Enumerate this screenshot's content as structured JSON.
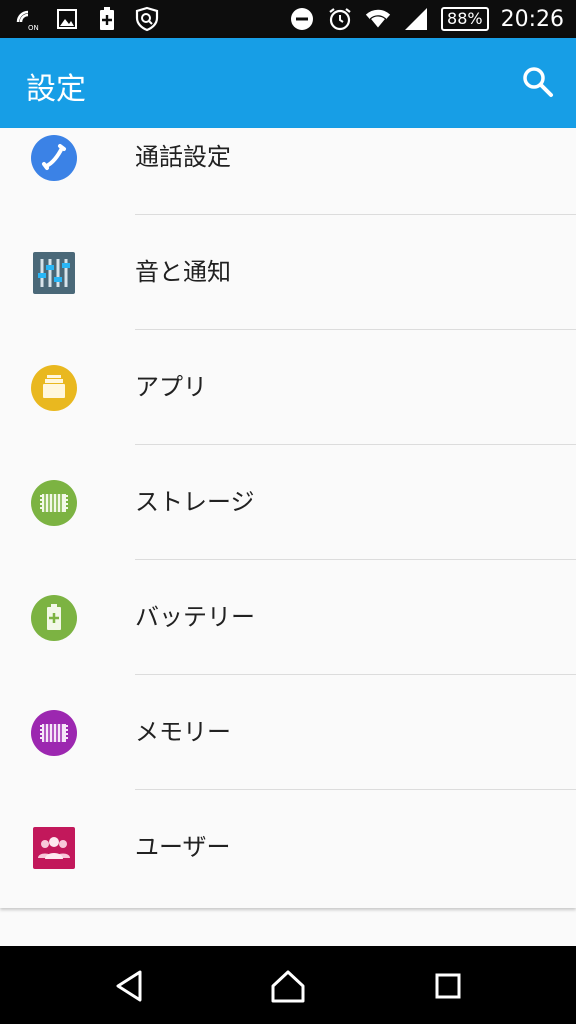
{
  "status_bar": {
    "battery_percent": "88%",
    "time": "20:26",
    "icons": [
      "nfc-on-icon",
      "image-icon",
      "battery-saver-icon",
      "shield-icon",
      "do-not-disturb-icon",
      "alarm-icon",
      "wifi-icon",
      "cellular-signal-icon"
    ]
  },
  "app_bar": {
    "title": "設定",
    "search_icon": "search-icon",
    "background": "#179ee6"
  },
  "settings": {
    "items": [
      {
        "label": "通話設定",
        "icon": "phone-call-icon",
        "color": "#3b82e6"
      },
      {
        "label": "音と通知",
        "icon": "equalizer-icon",
        "color": "#4a6878"
      },
      {
        "label": "アプリ",
        "icon": "apps-icon",
        "color": "#e9b81f"
      },
      {
        "label": "ストレージ",
        "icon": "storage-chip-icon",
        "color": "#7cb342"
      },
      {
        "label": "バッテリー",
        "icon": "battery-icon",
        "color": "#7cb342"
      },
      {
        "label": "メモリー",
        "icon": "memory-chip-icon",
        "color": "#9c27b0"
      },
      {
        "label": "ユーザー",
        "icon": "users-icon",
        "color": "#c2185b"
      }
    ]
  },
  "nav_bar": {
    "buttons": [
      "back-icon",
      "home-icon",
      "recents-icon"
    ]
  }
}
